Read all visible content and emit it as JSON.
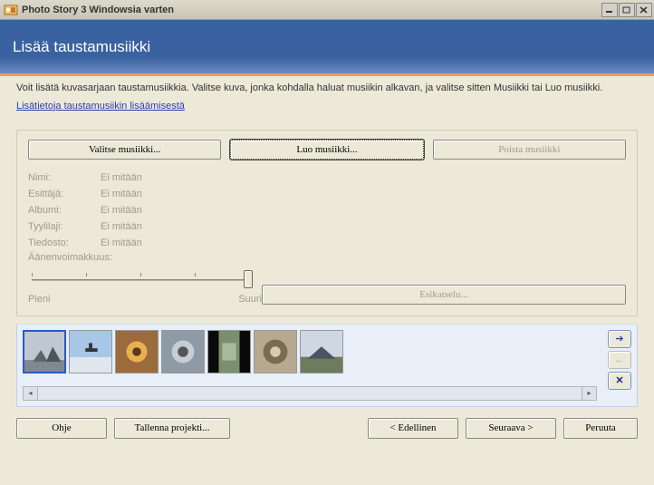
{
  "window": {
    "title": "Photo Story 3 Windowsia varten"
  },
  "header": {
    "title": "Lisää taustamusiikki"
  },
  "intro": {
    "text": "Voit lisätä kuvasarjaan taustamusiikkia. Valitse kuva, jonka kohdalla haluat musiikin alkavan, ja valitse sitten Musiikki tai Luo musiikki.",
    "link": "Lisätietoja taustamusiikin lisäämisestä"
  },
  "buttons": {
    "select_music": "Valitse musiikki...",
    "create_music": "Luo musiikki...",
    "remove_music": "Poista musiikki"
  },
  "meta": {
    "name_label": "Nimi:",
    "name_value": "Ei mitään",
    "artist_label": "Esittäjä:",
    "artist_value": "Ei mitään",
    "album_label": "Albumi:",
    "album_value": "Ei mitään",
    "genre_label": "Tyylilaji:",
    "genre_value": "Ei mitään",
    "file_label": "Tiedosto:",
    "file_value": "Ei mitään"
  },
  "volume": {
    "label": "Äänenvoimakkuus:",
    "min_label": "Pieni",
    "max_label": "Suuri"
  },
  "preview": {
    "label": "Esikatselu..."
  },
  "nav": {
    "help": "Ohje",
    "save": "Tallenna projekti...",
    "back": "< Edellinen",
    "next": "Seuraava >",
    "cancel": "Peruuta"
  }
}
